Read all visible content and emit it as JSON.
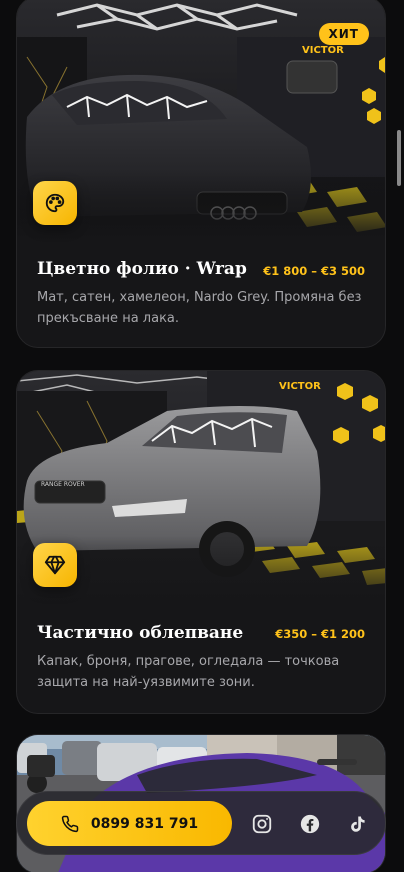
{
  "cards": [
    {
      "badge": "ХИТ",
      "icon": "palette-icon",
      "title": "Цветно фолио · Wrap",
      "price": "€1 800 – €3 500",
      "description": "Мат, сатен, хамелеон, Nardo Grey. Промяна без прекъсване на лака."
    },
    {
      "icon": "diamond-icon",
      "title": "Частично облепване",
      "price": "€350 – €1 200",
      "description": "Капак, броня, прагове, огледала — точкова защита на най-уязвимите зони."
    }
  ],
  "contact": {
    "phone": "0899 831 791",
    "phone_icon": "phone-icon",
    "socials": [
      "instagram-icon",
      "facebook-icon",
      "tiktok-icon"
    ]
  },
  "colors": {
    "accent": "#ffc21a",
    "background": "#0c0c0d",
    "card": "#161618"
  }
}
